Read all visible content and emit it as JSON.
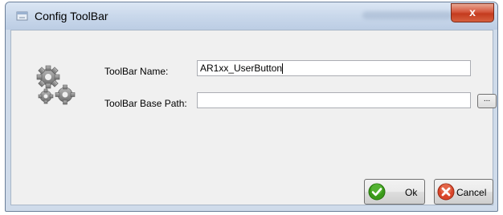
{
  "window": {
    "title": "Config ToolBar",
    "close_label": "x"
  },
  "form": {
    "name_label": "ToolBar Name:",
    "name_value": "AR1xx_UserButton",
    "path_label": "ToolBar Base Path:",
    "path_value": "",
    "browse_label": "..."
  },
  "buttons": {
    "ok_label": "Ok",
    "cancel_label": "Cancel"
  },
  "icons": {
    "window_icon": "window-app-icon",
    "settings": "gears-icon",
    "ok": "green-checkmark-icon",
    "cancel": "red-x-icon"
  },
  "colors": {
    "title_bar": "#c9d8eb",
    "close_button": "#c43b1e",
    "ok_icon": "#3a9a1a",
    "cancel_icon": "#d9452a"
  }
}
